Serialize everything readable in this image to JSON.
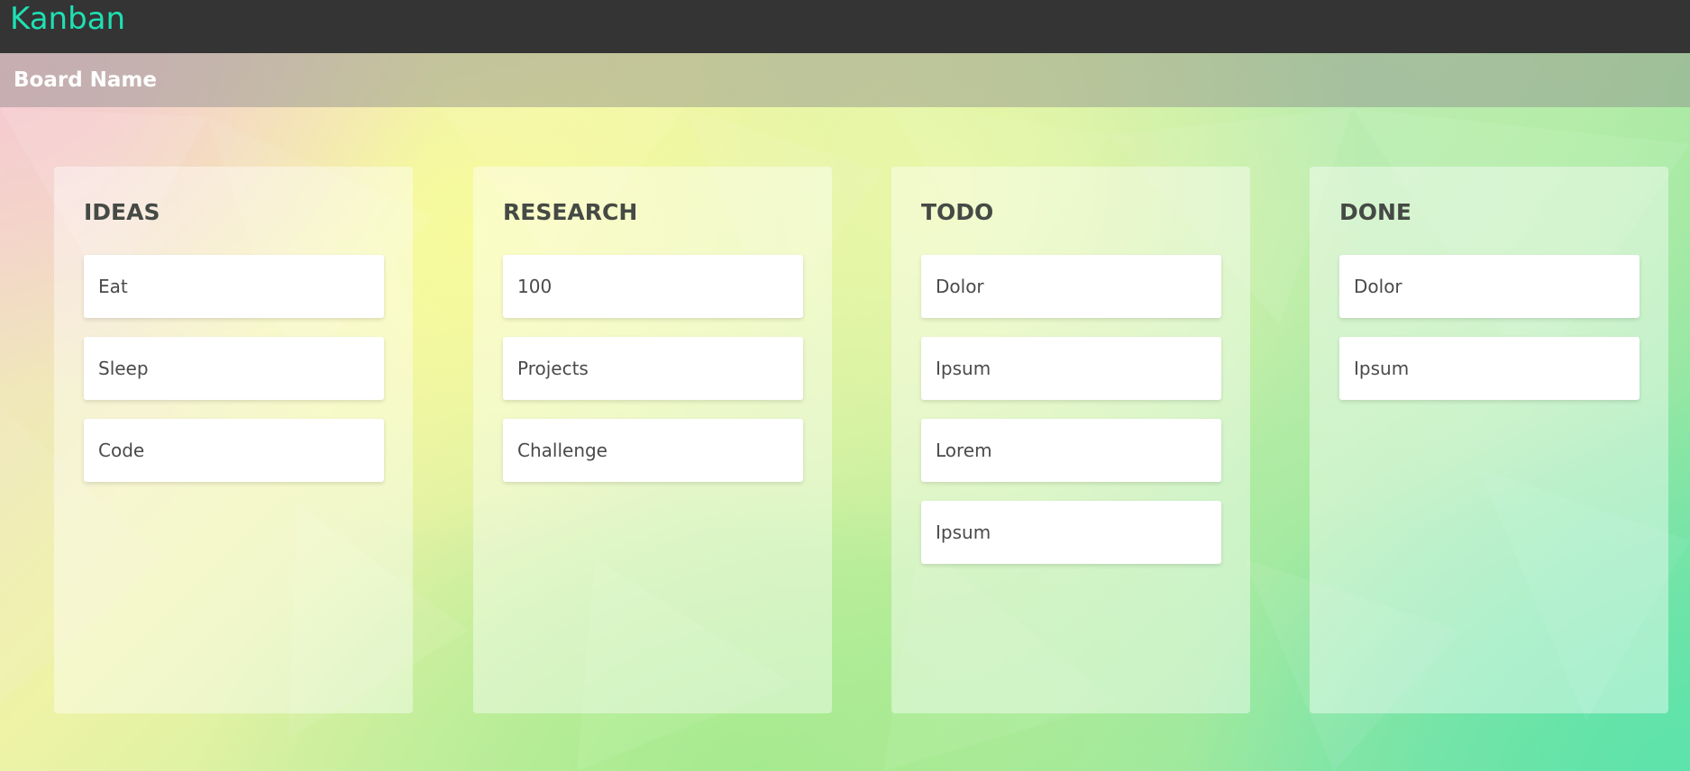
{
  "app": {
    "title": "Kanban",
    "accent_color": "#1fe0b4",
    "topbar_color": "#343434"
  },
  "board": {
    "name": "Board Name"
  },
  "columns": [
    {
      "title": "IDEAS",
      "cards": [
        "Eat",
        "Sleep",
        "Code"
      ]
    },
    {
      "title": "RESEARCH",
      "cards": [
        "100",
        "Projects",
        "Challenge"
      ]
    },
    {
      "title": "TODO",
      "cards": [
        "Dolor",
        "Ipsum",
        "Lorem",
        "Ipsum"
      ]
    },
    {
      "title": "DONE",
      "cards": [
        "Dolor",
        "Ipsum"
      ]
    }
  ]
}
